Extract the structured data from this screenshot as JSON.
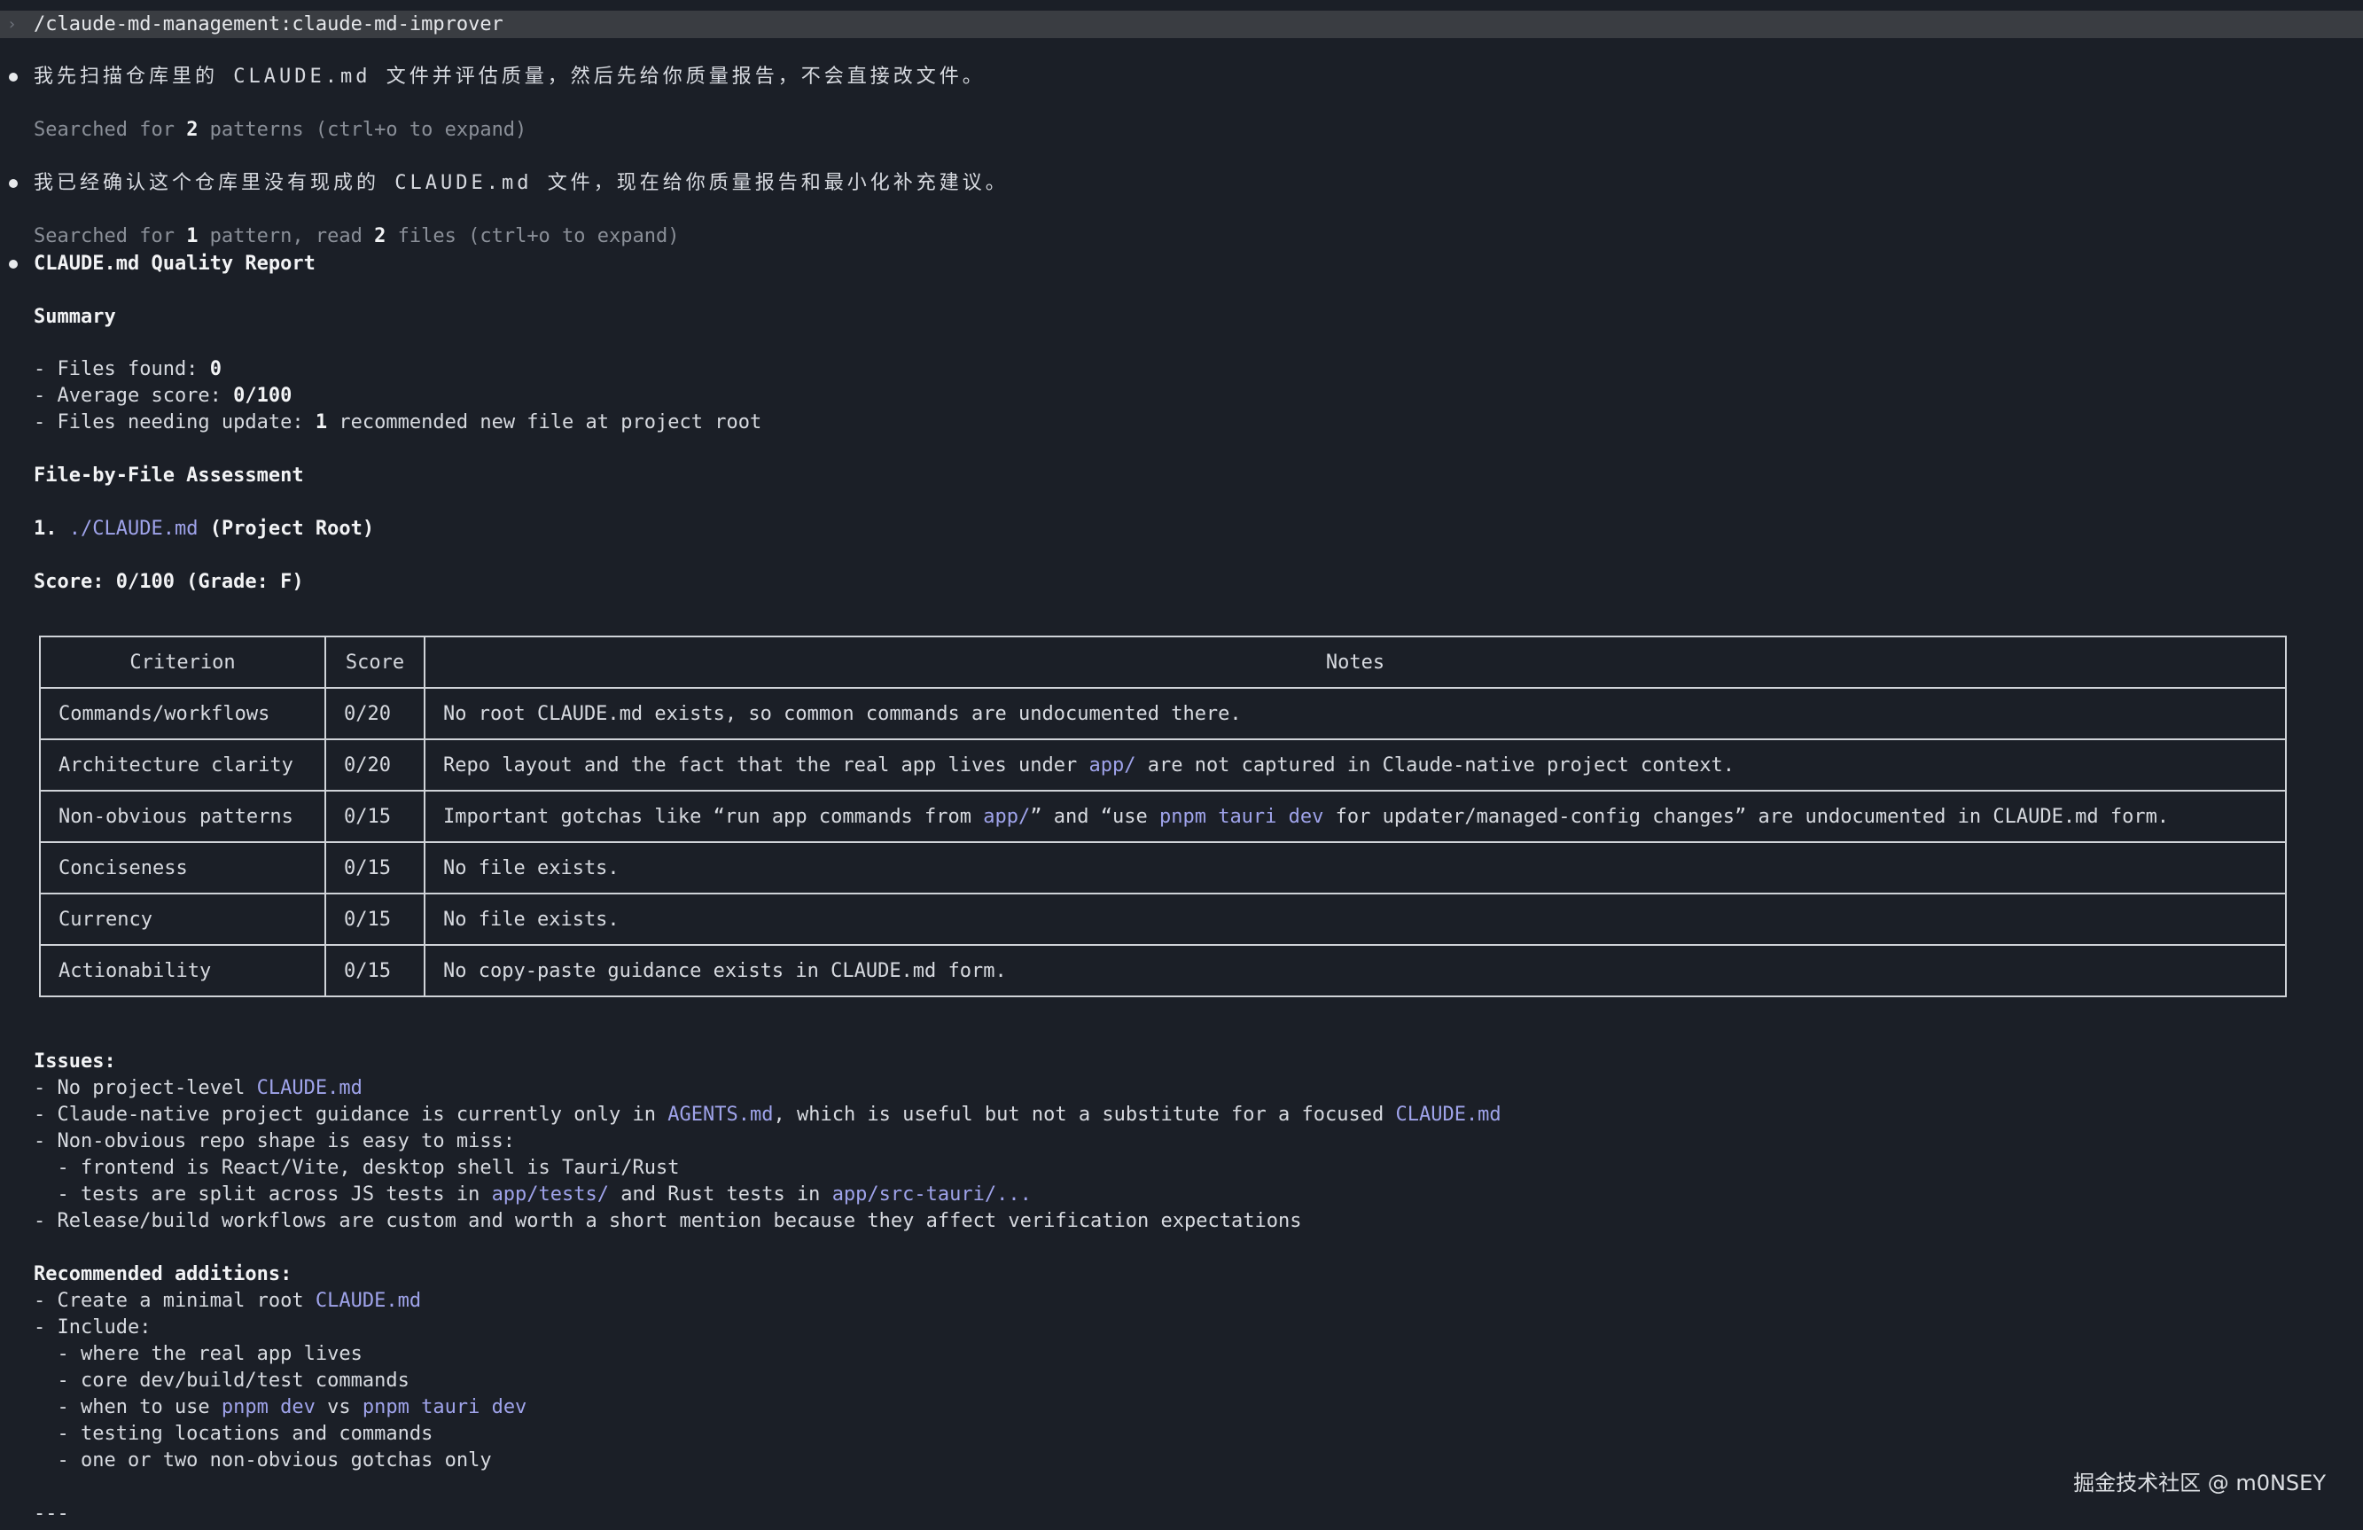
{
  "command_bar": {
    "chevron": "›",
    "command": "/claude-md-management:claude-md-improver"
  },
  "messages": {
    "m1_text": "我先扫描仓库里的 CLAUDE.md 文件并评估质量，然后先给你质量报告，不会直接改文件。",
    "m1_note_a": "Searched for ",
    "m1_note_count": "2",
    "m1_note_b": " patterns (ctrl+o to expand)",
    "m2_text": "我已经确认这个仓库里没有现成的 CLAUDE.md 文件，现在给你质量报告和最小化补充建议。",
    "m2_note_a": "Searched for ",
    "m2_note_count1": "1",
    "m2_note_mid": " pattern, read ",
    "m2_note_count2": "2",
    "m2_note_b": " files (ctrl+o to expand)"
  },
  "report": {
    "title": "CLAUDE.md Quality Report",
    "summary_heading": "Summary",
    "files_found_label": "- Files found: ",
    "files_found_value": "0",
    "avg_score_label": "- Average score: ",
    "avg_score_value": "0/100",
    "needing_update_label": "- Files needing update: ",
    "needing_update_value": "1",
    "needing_update_rest": " recommended new file at project root",
    "assessment_heading": "File-by-File Assessment",
    "item_number": "1. ",
    "item_path": "./CLAUDE.md",
    "item_suffix": " (Project Root)",
    "score_line": "Score: 0/100 (Grade: F)"
  },
  "table": {
    "headers": [
      "Criterion",
      "Score",
      "Notes"
    ],
    "rows": [
      {
        "criterion": "Commands/workflows",
        "score": "0/20",
        "notes": "No root CLAUDE.md exists, so common commands are undocumented there."
      },
      {
        "criterion": "Architecture clarity",
        "score": "0/20",
        "n1": "Repo layout and the fact that the real app lives under ",
        "n1_code": "app/",
        "n1_rest": " are not captured in Claude-native project context."
      },
      {
        "criterion": "Non-obvious patterns",
        "score": "0/15",
        "n2a": "Important gotchas like “run app commands from ",
        "n2_code1": "app/",
        "n2b": "” and “use ",
        "n2_code2": "pnpm tauri dev",
        "n2c": " for updater/managed-config changes” are undocumented in CLAUDE.md form."
      },
      {
        "criterion": "Conciseness",
        "score": "0/15",
        "notes": "No file exists."
      },
      {
        "criterion": "Currency",
        "score": "0/15",
        "notes": "No file exists."
      },
      {
        "criterion": "Actionability",
        "score": "0/15",
        "notes": "No copy-paste guidance exists in CLAUDE.md form."
      }
    ]
  },
  "issues": {
    "heading": "Issues:",
    "i1_a": "- No project-level ",
    "i1_code": "CLAUDE.md",
    "i2_a": "- Claude-native project guidance is currently only in ",
    "i2_code1": "AGENTS.md",
    "i2_b": ", which is useful but not a substitute for a focused ",
    "i2_code2": "CLAUDE.md",
    "i3": "- Non-obvious repo shape is easy to miss:",
    "i3_sub1": "  - frontend is React/Vite, desktop shell is Tauri/Rust",
    "i3_sub2_a": "  - tests are split across JS tests in ",
    "i3_sub2_code1": "app/tests/",
    "i3_sub2_b": " and Rust tests in ",
    "i3_sub2_code2": "app/src-tauri/...",
    "i4": "- Release/build workflows are custom and worth a short mention because they affect verification expectations"
  },
  "recommended": {
    "heading": "Recommended additions:",
    "r1_a": "- Create a minimal root ",
    "r1_code": "CLAUDE.md",
    "r2": "- Include:",
    "r2_s1": "  - where the real app lives",
    "r2_s2": "  - core dev/build/test commands",
    "r2_s3_a": "  - when to use ",
    "r2_s3_code1": "pnpm dev",
    "r2_s3_b": " vs ",
    "r2_s3_code2": "pnpm tauri dev",
    "r2_s4": "  - testing locations and commands",
    "r2_s5": "  - one or two non-obvious gotchas only"
  },
  "divider": "---",
  "watermark": "掘金技术社区 @ m0NSEY"
}
